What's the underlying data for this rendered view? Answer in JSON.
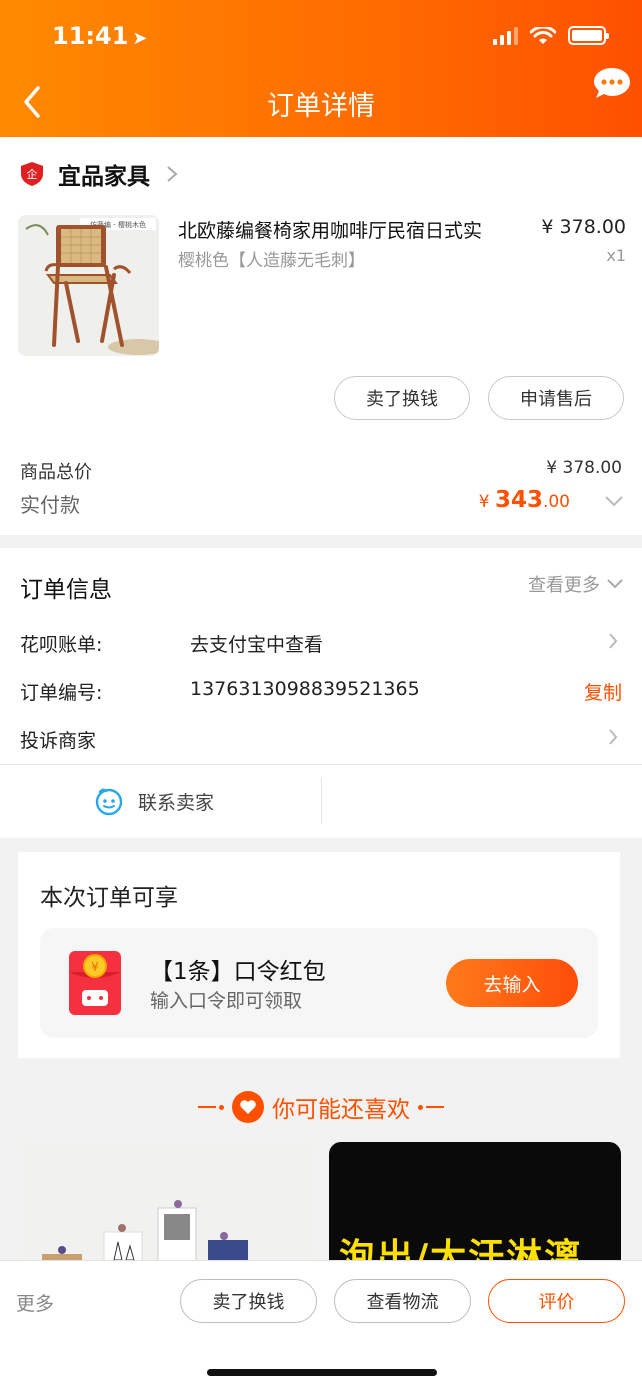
{
  "status": {
    "time": "11:41"
  },
  "header": {
    "title": "订单详情"
  },
  "shop": {
    "name": "宜品家具"
  },
  "product": {
    "title": "北欧藤编餐椅家用咖啡厅民宿日式实",
    "sku": "樱桃色【人造藤无毛刺】",
    "price": "¥ 378.00",
    "qty": "x1"
  },
  "actions": {
    "sell": "卖了换钱",
    "after_sale": "申请售后"
  },
  "summary": {
    "total_label": "商品总价",
    "total_value": "¥ 378.00",
    "paid_label": "实付款",
    "paid_currency": "¥",
    "paid_int": "343",
    "paid_dec": ".00"
  },
  "order_info": {
    "title": "订单信息",
    "more": "查看更多",
    "huabei_label": "花呗账单:",
    "huabei_value": "去支付宝中查看",
    "order_no_label": "订单编号:",
    "order_no_value": "1376313098839521365",
    "copy": "复制",
    "complain": "投诉商家",
    "contact": "联系卖家"
  },
  "bonus": {
    "title": "本次订单可享",
    "name": "【1条】口令红包",
    "sub": "输入口令即可领取",
    "button": "去输入"
  },
  "guess": {
    "title": "你可能还喜欢",
    "rec_right_text": "泡出/大汗淋漓"
  },
  "bottom": {
    "more": "更多",
    "sell": "卖了换钱",
    "logistics": "查看物流",
    "review": "评价"
  },
  "colors": {
    "brand": "#ff5000",
    "header_start": "#ff8a00"
  }
}
